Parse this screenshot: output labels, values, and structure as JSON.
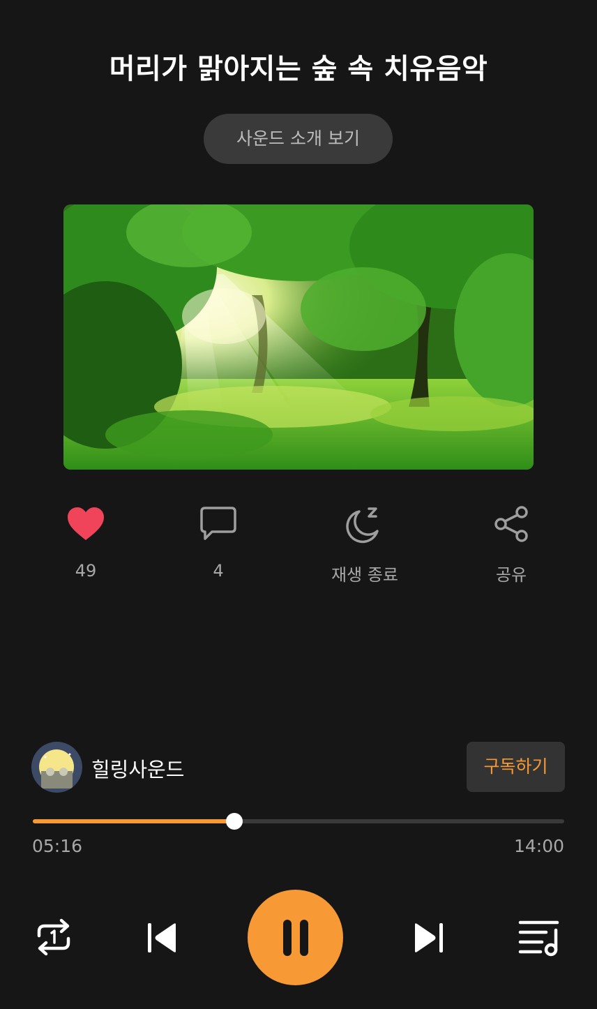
{
  "title": "머리가 맑아지는 숲 속 치유음악",
  "intro_button": "사운드 소개 보기",
  "cover_image": "sunlit-forest-image",
  "actions": [
    {
      "icon": "heart-icon",
      "label": "49"
    },
    {
      "icon": "comment-icon",
      "label": "4"
    },
    {
      "icon": "sleep-timer-icon",
      "label": "재생 종료"
    },
    {
      "icon": "share-icon",
      "label": "공유"
    }
  ],
  "channel": {
    "name": "힐링사운드",
    "subscribe_label": "구독하기"
  },
  "player": {
    "current_time": "05:16",
    "total_time": "14:00",
    "progress": 0.379,
    "state": "playing"
  },
  "controls": [
    "repeat-one-icon",
    "previous-icon",
    "pause-icon",
    "next-icon",
    "playlist-icon"
  ],
  "colors": {
    "background": "#161616",
    "accent": "#f79a36",
    "heart": "#f0445a",
    "muted_text": "#a8a8a8"
  }
}
